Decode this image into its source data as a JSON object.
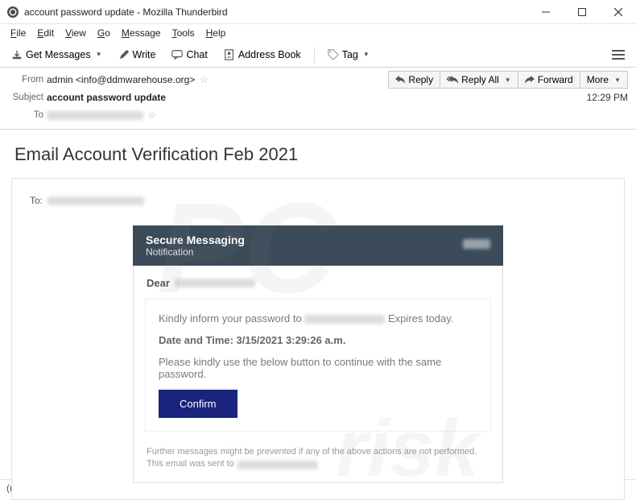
{
  "window": {
    "title": "account password update - Mozilla Thunderbird"
  },
  "menu": {
    "file": "File",
    "edit": "Edit",
    "view": "View",
    "go": "Go",
    "message": "Message",
    "tools": "Tools",
    "help": "Help"
  },
  "toolbar": {
    "get_messages": "Get Messages",
    "write": "Write",
    "chat": "Chat",
    "address_book": "Address Book",
    "tag": "Tag"
  },
  "header": {
    "from_label": "From",
    "from_value": "admin <info@ddmwarehouse.org>",
    "subject_label": "Subject",
    "subject_value": "account password update",
    "to_label": "To",
    "time": "12:29 PM",
    "actions": {
      "reply": "Reply",
      "reply_all": "Reply All",
      "forward": "Forward",
      "more": "More"
    }
  },
  "email": {
    "title": "Email Account Verification Feb 2021",
    "to_prefix": "To:",
    "secure": {
      "line1": "Secure Messaging",
      "line2": "Notification"
    },
    "dear": "Dear",
    "body_p1_a": "Kindly inform your password to ",
    "body_p1_b": " Expires today.",
    "body_p2": "Date and Time: 3/15/2021 3:29:26 a.m.",
    "body_p3": "Please kindly use the below button to continue with the same password.",
    "confirm": "Confirm",
    "foot1": "Further messages might be prevented if any of the above actions are not performed.",
    "foot2": "This email was sent to "
  }
}
